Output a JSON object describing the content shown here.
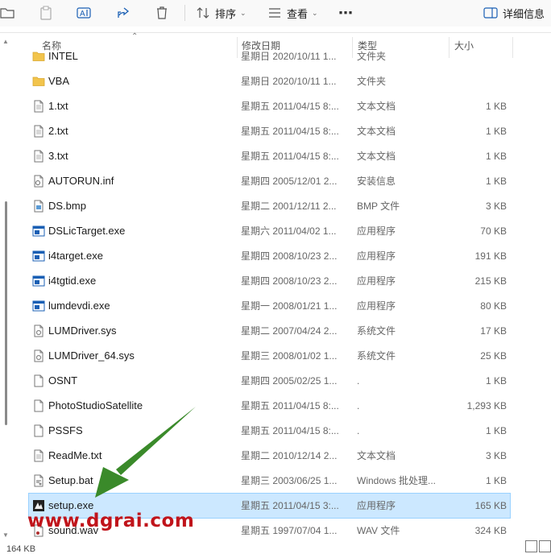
{
  "toolbar": {
    "sort_label": "排序",
    "view_label": "查看",
    "details_label": "详细信息",
    "icons": [
      "new-folder-icon",
      "paste-icon",
      "rename-icon",
      "share-icon",
      "delete-icon",
      "sort-icon",
      "view-icon",
      "more-icon",
      "details-pane-icon"
    ]
  },
  "columns": {
    "name": "名称",
    "date": "修改日期",
    "type": "类型",
    "size": "大小"
  },
  "files": [
    {
      "name": "INTEL",
      "date": "星期日 2020/10/11 1...",
      "type": "文件夹",
      "size": "",
      "icon": "folder-icon"
    },
    {
      "name": "VBA",
      "date": "星期日 2020/10/11 1...",
      "type": "文件夹",
      "size": "",
      "icon": "folder-icon"
    },
    {
      "name": "1.txt",
      "date": "星期五 2011/04/15 8:...",
      "type": "文本文档",
      "size": "1 KB",
      "icon": "text-file-icon"
    },
    {
      "name": "2.txt",
      "date": "星期五 2011/04/15 8:...",
      "type": "文本文档",
      "size": "1 KB",
      "icon": "text-file-icon"
    },
    {
      "name": "3.txt",
      "date": "星期五 2011/04/15 8:...",
      "type": "文本文档",
      "size": "1 KB",
      "icon": "text-file-icon"
    },
    {
      "name": "AUTORUN.inf",
      "date": "星期四 2005/12/01 2...",
      "type": "安装信息",
      "size": "1 KB",
      "icon": "setup-info-icon"
    },
    {
      "name": "DS.bmp",
      "date": "星期二 2001/12/11 2...",
      "type": "BMP 文件",
      "size": "3 KB",
      "icon": "image-file-icon"
    },
    {
      "name": "DSLicTarget.exe",
      "date": "星期六 2011/04/02 1...",
      "type": "应用程序",
      "size": "70 KB",
      "icon": "application-icon"
    },
    {
      "name": "i4target.exe",
      "date": "星期四 2008/10/23 2...",
      "type": "应用程序",
      "size": "191 KB",
      "icon": "application-icon"
    },
    {
      "name": "i4tgtid.exe",
      "date": "星期四 2008/10/23 2...",
      "type": "应用程序",
      "size": "215 KB",
      "icon": "application-icon"
    },
    {
      "name": "lumdevdi.exe",
      "date": "星期一 2008/01/21 1...",
      "type": "应用程序",
      "size": "80 KB",
      "icon": "application-icon"
    },
    {
      "name": "LUMDriver.sys",
      "date": "星期二 2007/04/24 2...",
      "type": "系统文件",
      "size": "17 KB",
      "icon": "system-file-icon"
    },
    {
      "name": "LUMDriver_64.sys",
      "date": "星期三 2008/01/02 1...",
      "type": "系统文件",
      "size": "25 KB",
      "icon": "system-file-icon"
    },
    {
      "name": "OSNT",
      "date": "星期四 2005/02/25 1...",
      "type": ".",
      "size": "1 KB",
      "icon": "blank-file-icon"
    },
    {
      "name": "PhotoStudioSatellite",
      "date": "星期五 2011/04/15 8:...",
      "type": ".",
      "size": "1,293 KB",
      "icon": "blank-file-icon"
    },
    {
      "name": "PSSFS",
      "date": "星期五 2011/04/15 8:...",
      "type": ".",
      "size": "1 KB",
      "icon": "blank-file-icon"
    },
    {
      "name": "ReadMe.txt",
      "date": "星期二 2010/12/14 2...",
      "type": "文本文档",
      "size": "3 KB",
      "icon": "text-file-icon"
    },
    {
      "name": "Setup.bat",
      "date": "星期三 2003/06/25 1...",
      "type": "Windows 批处理...",
      "size": "1 KB",
      "icon": "batch-file-icon"
    },
    {
      "name": "setup.exe",
      "date": "星期五 2011/04/15 3:...",
      "type": "应用程序",
      "size": "165 KB",
      "icon": "setup-exe-icon",
      "selected": true
    },
    {
      "name": "sound.wav",
      "date": "星期五 1997/07/04 1...",
      "type": "WAV 文件",
      "size": "324 KB",
      "icon": "audio-file-icon"
    }
  ],
  "status": {
    "text": "164 KB"
  },
  "watermark": {
    "text": "www.dgrai.com"
  },
  "colors": {
    "selection": "#cce8ff",
    "arrow": "#3a8a2a",
    "watermark": "#c0141b",
    "folder": "#f2c44c"
  }
}
